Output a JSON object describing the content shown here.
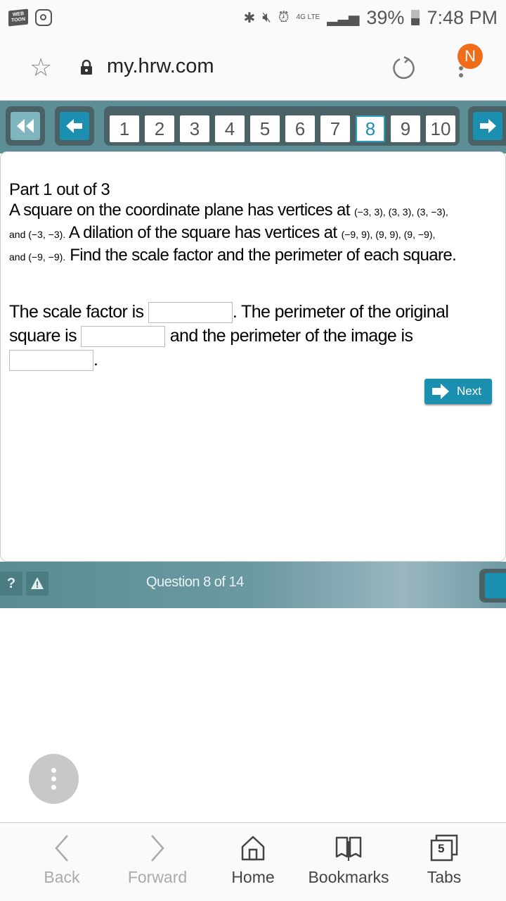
{
  "status_bar": {
    "apps": [
      "WEB TOON",
      "instagram"
    ],
    "battery": "39%",
    "time": "7:48 PM",
    "network": "4G LTE"
  },
  "browser": {
    "url": "my.hrw.com",
    "avatar_initial": "N"
  },
  "pager": {
    "pages": [
      "1",
      "2",
      "3",
      "4",
      "5",
      "6",
      "7",
      "8",
      "9",
      "10"
    ],
    "active_page": "8"
  },
  "question": {
    "part": "Part 1 out of 3",
    "text_1": "A square on the coordinate plane has vertices at ",
    "coords_1": "(−3, 3), (3, 3), (3, −3),",
    "coords_2": "and (−3, −3).",
    "text_2": " A dilation of the square has vertices at ",
    "coords_3": "(−9, 9), (9, 9), (9, −9),",
    "coords_4": "and (−9, −9).",
    "text_3": " Find the scale factor and the perimeter of each square.",
    "answer_1": "The scale factor is ",
    "answer_2": ". The perimeter of the original square is ",
    "answer_3": " and the perimeter of the image is ",
    "answer_4": ".",
    "scale_factor_value": "",
    "original_perimeter_value": "",
    "image_perimeter_value": "",
    "next_label": "Next"
  },
  "footer": {
    "help_label": "?",
    "warn_label": "!",
    "question_count": "Question 8 of 14"
  },
  "bottom_nav": {
    "back": "Back",
    "forward": "Forward",
    "home": "Home",
    "bookmarks": "Bookmarks",
    "tabs": "Tabs",
    "tab_count": "5"
  }
}
